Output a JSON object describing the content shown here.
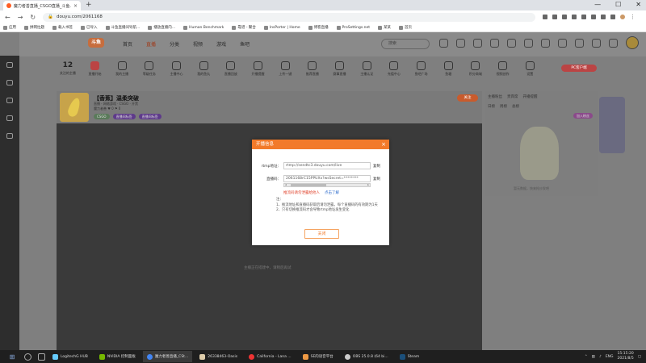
{
  "browser": {
    "tab_title": "魔力者善直播_CSGO直播_斗鱼...",
    "tab_close": "×",
    "new_tab": "+",
    "window_controls": [
      "—",
      "☐",
      "✕"
    ],
    "back": "←",
    "forward": "→",
    "reload": "↻",
    "url": "douyu.com/2061168",
    "bookmarks": [
      "应用",
      "拼网拉题",
      "载入书签",
      "已导入",
      "斗鱼直播间导航...",
      "播放直播内...",
      "Human Benchmark",
      "靠谱 - 聚合",
      "InsPorter | Home",
      "博客直播",
      "ProSettings.net",
      "某某",
      "首页"
    ]
  },
  "site": {
    "logo": "斗鱼",
    "nav": [
      "首页",
      "直播",
      "分类",
      "视频",
      "游戏",
      "鱼吧"
    ],
    "search_placeholder": "搜索",
    "pc_download": "PC客户端",
    "categories": [
      {
        "num": "12",
        "label": "关注的主播"
      },
      {
        "label": "直播开始"
      },
      {
        "label": "我的主播"
      },
      {
        "label": "等级任务"
      },
      {
        "label": "主播中心"
      },
      {
        "label": "我的鱼丸"
      },
      {
        "label": "直播回放"
      },
      {
        "label": "开播提醒"
      },
      {
        "label": "上传一键"
      },
      {
        "label": "推荐直播"
      },
      {
        "label": "赛事直播"
      },
      {
        "label": "主播认证"
      },
      {
        "label": "充值中心"
      },
      {
        "label": "鱼吧广场"
      },
      {
        "label": "鱼塘"
      },
      {
        "label": "积分商城"
      },
      {
        "label": "视频创作"
      },
      {
        "label": "设置"
      }
    ]
  },
  "room": {
    "title": "【香蕉】温柔突破",
    "subtitle": "直播 · 网络游戏 · CSGO · 开黑",
    "meta": "魔力者善  ♥ 0  ⚑ 0",
    "tags": [
      "CSGO",
      "直播间标签",
      "直播间标签"
    ],
    "follow": "关注",
    "avatar_caption": "香蕉直播",
    "video_message": "主播正在搭建中，请稍后再试"
  },
  "right_panel": {
    "tabs": [
      "主播粉丝",
      "贵宾席",
      "开播提醒"
    ],
    "row": [
      "日榜",
      "周榜",
      "总榜"
    ],
    "join_button": "加入粉丝",
    "empty_text": "暂无数据，快来抢沙发吧"
  },
  "modal": {
    "title": "开播信息",
    "close": "×",
    "rtmp_label": "rtmp地址：",
    "rtmp_value": "rtmp://sendtc3.douyu.com/live",
    "code_label": "直播码：",
    "code_value": "2061168rC15PPUXx?wsSecret=********",
    "copy": "复制",
    "warning": "推流码请勿泄露给他人",
    "learn_more": "点击了解",
    "note_title": "注：",
    "note_1": "1、推流地址和直播码获取后请勿泄露，每个直播码的有效期为1天",
    "note_2": "2、只有切换推流码才会导致rtmp地址发生变化",
    "close_button": "关闭"
  },
  "taskbar": {
    "apps": [
      "LogitechG HUB",
      "NVIDIA 控制面板",
      "魔力者善直播_CSt...",
      "26338463-Oasis",
      "California - Lana ...",
      "SE的语音平台",
      "OBS 25.0.8 (64 bi...",
      "Steam"
    ],
    "lang": "ENG",
    "time": "15:15:20",
    "date": "2021/8/5"
  },
  "colors": {
    "accent": "#f27a2a",
    "warning": "#e0412a",
    "link": "#2a6acc"
  }
}
